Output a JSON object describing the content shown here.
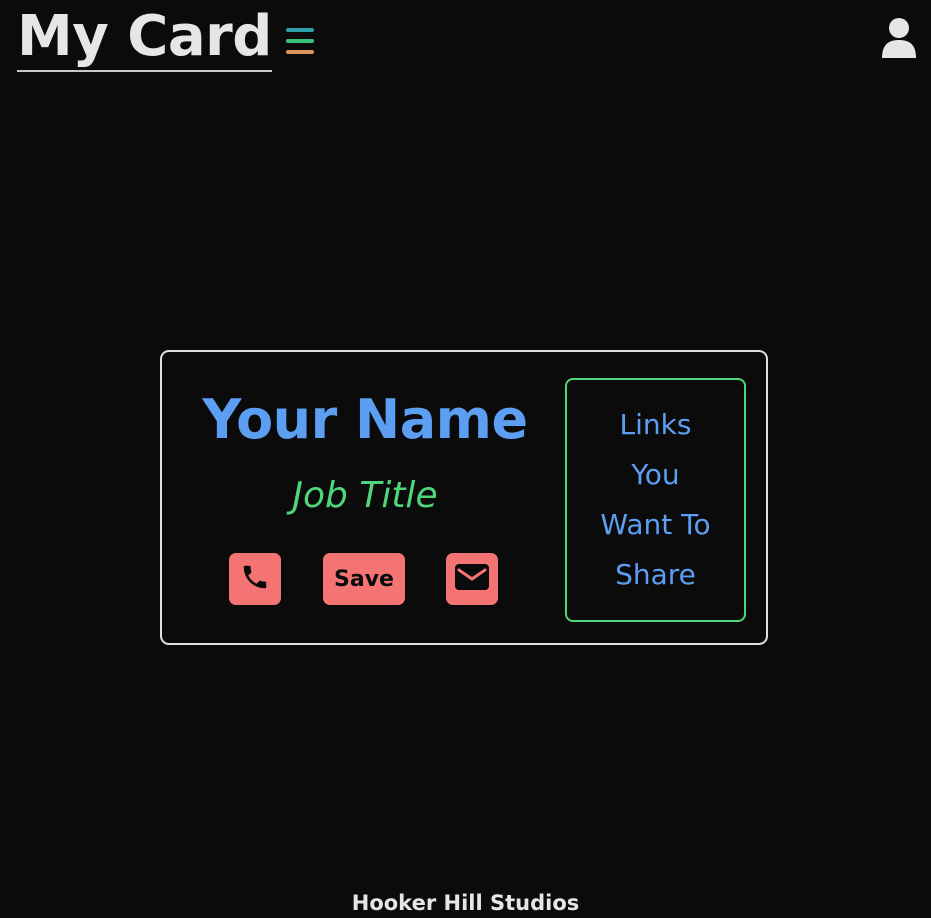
{
  "header": {
    "title": "My Card",
    "menu_icon": "hamburger-menu-icon",
    "user_icon": "user-icon",
    "menu_colors": [
      "#2e9fa8",
      "#39c07a",
      "#d9975a"
    ]
  },
  "card": {
    "name": "Your Name",
    "job_title": "Job Title",
    "actions": {
      "phone_icon": "phone-icon",
      "save_label": "Save",
      "mail_icon": "envelope-icon"
    },
    "links_lines": [
      "Links",
      "You",
      "Want To",
      "Share"
    ]
  },
  "footer": {
    "text": "Hooker Hill Studios"
  },
  "colors": {
    "background": "#0b0b0b",
    "name": "#5b9ef2",
    "job_title": "#4fd67a",
    "action_button": "#f47474",
    "links_border": "#4fd67a",
    "card_border": "#e0e0e0"
  }
}
